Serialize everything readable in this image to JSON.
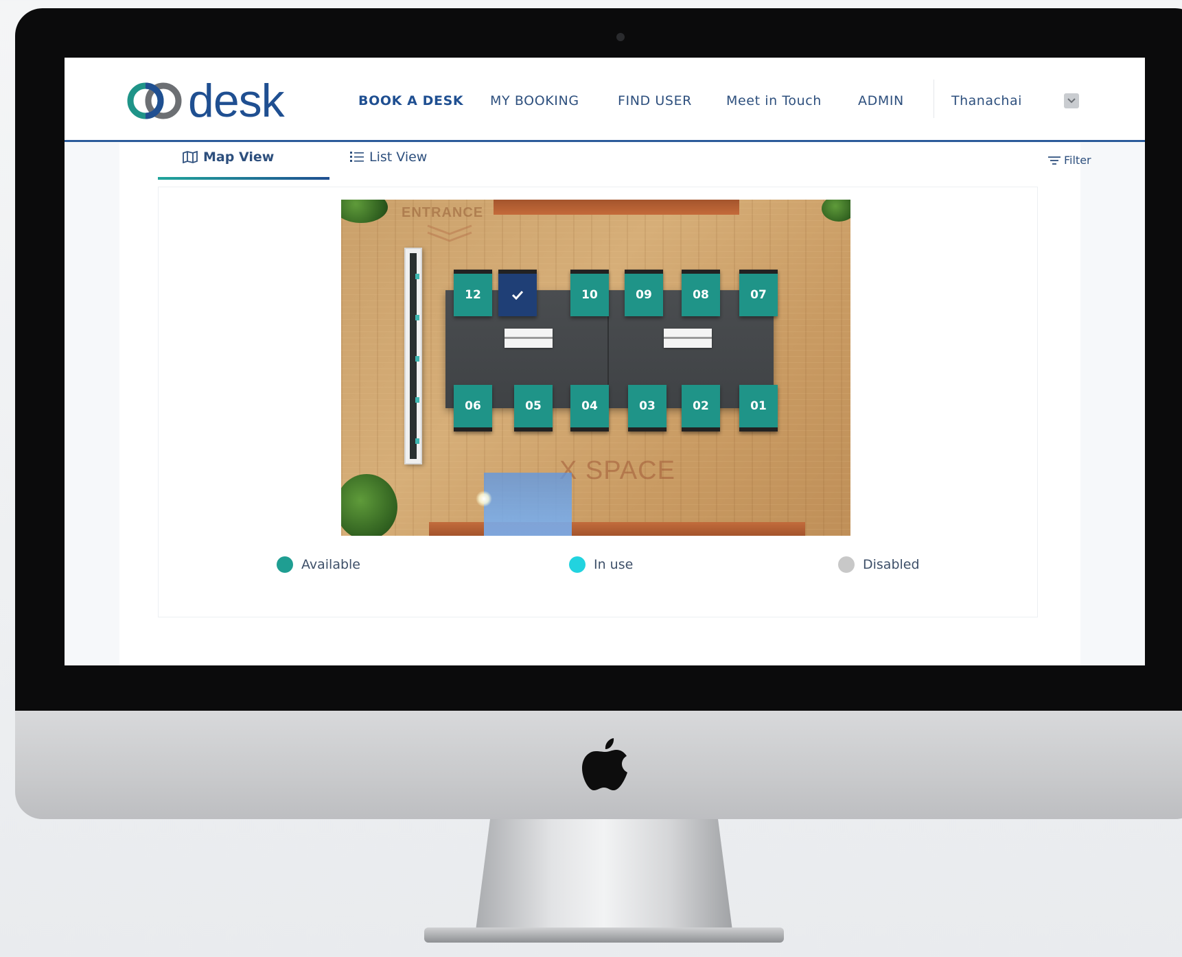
{
  "app": {
    "logo_text": "desk",
    "brand_color": "#1f4f91",
    "accent_color": "#20a59b"
  },
  "nav": {
    "items": [
      {
        "label": "BOOK A DESK",
        "active": true
      },
      {
        "label": "MY BOOKING",
        "active": false
      },
      {
        "label": "FIND USER",
        "active": false
      },
      {
        "label": "Meet in Touch",
        "active": false
      },
      {
        "label": "ADMIN",
        "active": false
      }
    ],
    "user_name": "Thanachai",
    "user_menu_icon": "chevron-down-icon"
  },
  "view_tabs": [
    {
      "label": "Map View",
      "icon": "map-icon",
      "active": true
    },
    {
      "label": "List View",
      "icon": "list-icon",
      "active": false
    }
  ],
  "filter": {
    "label": "Filter",
    "icon": "filter-icon"
  },
  "floor_plan": {
    "entrance_label": "ENTRANCE",
    "space_label": "X SPACE",
    "seats_top": [
      {
        "label": "12",
        "status": "available"
      },
      {
        "label": "",
        "status": "selected",
        "icon": "check-icon"
      },
      {
        "label": "10",
        "status": "available"
      },
      {
        "label": "09",
        "status": "available"
      },
      {
        "label": "08",
        "status": "available"
      },
      {
        "label": "07",
        "status": "available"
      }
    ],
    "seats_bottom": [
      {
        "label": "06",
        "status": "available"
      },
      {
        "label": "05",
        "status": "available"
      },
      {
        "label": "04",
        "status": "available"
      },
      {
        "label": "03",
        "status": "available"
      },
      {
        "label": "02",
        "status": "available"
      },
      {
        "label": "01",
        "status": "available"
      }
    ],
    "seat_colors": {
      "available": "#1f9488",
      "selected": "#1f3f76"
    }
  },
  "legend": [
    {
      "label": "Available",
      "color": "#1f9e92"
    },
    {
      "label": "In use",
      "color": "#22d3df"
    },
    {
      "label": "Disabled",
      "color": "#c8c8c8"
    }
  ]
}
